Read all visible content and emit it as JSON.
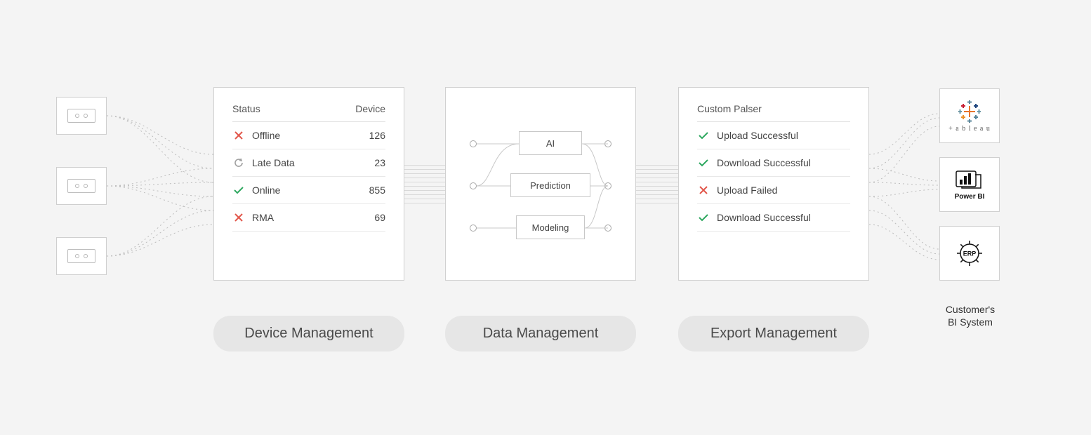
{
  "device_management": {
    "header_status": "Status",
    "header_device": "Device",
    "rows": [
      {
        "label": "Offline",
        "count": "126",
        "icon": "cross"
      },
      {
        "label": "Late Data",
        "count": "23",
        "icon": "refresh"
      },
      {
        "label": "Online",
        "count": "855",
        "icon": "check"
      },
      {
        "label": "RMA",
        "count": "69",
        "icon": "cross"
      }
    ],
    "pill": "Device Management"
  },
  "data_management": {
    "nodes": {
      "ai": "AI",
      "prediction": "Prediction",
      "modeling": "Modeling"
    },
    "pill": "Data Management"
  },
  "export_management": {
    "title": "Custom Palser",
    "rows": [
      {
        "label": "Upload Successful",
        "icon": "check"
      },
      {
        "label": "Download Successful",
        "icon": "check"
      },
      {
        "label": "Upload Failed",
        "icon": "cross"
      },
      {
        "label": "Download Successful",
        "icon": "check"
      }
    ],
    "pill": "Export Management"
  },
  "bi": {
    "tableau": "+ a b l e a u",
    "powerbi": "Power BI",
    "erp": "ERP",
    "caption_line1": "Customer's",
    "caption_line2": "BI System"
  }
}
